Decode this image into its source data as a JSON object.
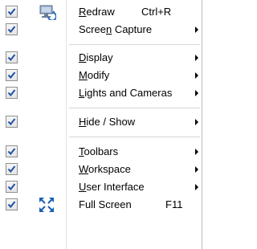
{
  "menu": {
    "items": [
      {
        "pre": "",
        "acc": "R",
        "post": "edraw",
        "shortcut": "Ctrl+R",
        "submenu": false,
        "checked": true,
        "icon": "redraw-icon"
      },
      {
        "pre": "Scree",
        "acc": "n",
        "post": " Capture",
        "shortcut": "",
        "submenu": true,
        "checked": true,
        "icon": ""
      },
      {
        "pre": "",
        "acc": "D",
        "post": "isplay",
        "shortcut": "",
        "submenu": true,
        "checked": true,
        "icon": ""
      },
      {
        "pre": "",
        "acc": "M",
        "post": "odify",
        "shortcut": "",
        "submenu": true,
        "checked": true,
        "icon": ""
      },
      {
        "pre": "",
        "acc": "L",
        "post": "ights and Cameras",
        "shortcut": "",
        "submenu": true,
        "checked": true,
        "icon": ""
      },
      {
        "pre": "",
        "acc": "H",
        "post": "ide / Show",
        "shortcut": "",
        "submenu": true,
        "checked": true,
        "icon": ""
      },
      {
        "pre": "",
        "acc": "T",
        "post": "oolbars",
        "shortcut": "",
        "submenu": true,
        "checked": true,
        "icon": ""
      },
      {
        "pre": "",
        "acc": "W",
        "post": "orkspace",
        "shortcut": "",
        "submenu": true,
        "checked": true,
        "icon": ""
      },
      {
        "pre": "",
        "acc": "U",
        "post": "ser Interface",
        "shortcut": "",
        "submenu": true,
        "checked": true,
        "icon": ""
      },
      {
        "pre": "Full Screen",
        "acc": "",
        "post": "",
        "shortcut": "F11",
        "submenu": false,
        "checked": true,
        "icon": "full-screen-icon"
      }
    ],
    "colors": {
      "check": "#1e4fa8",
      "redraw_icon": "#2b6cc4",
      "full_screen_icon": "#1a5fb4"
    }
  }
}
